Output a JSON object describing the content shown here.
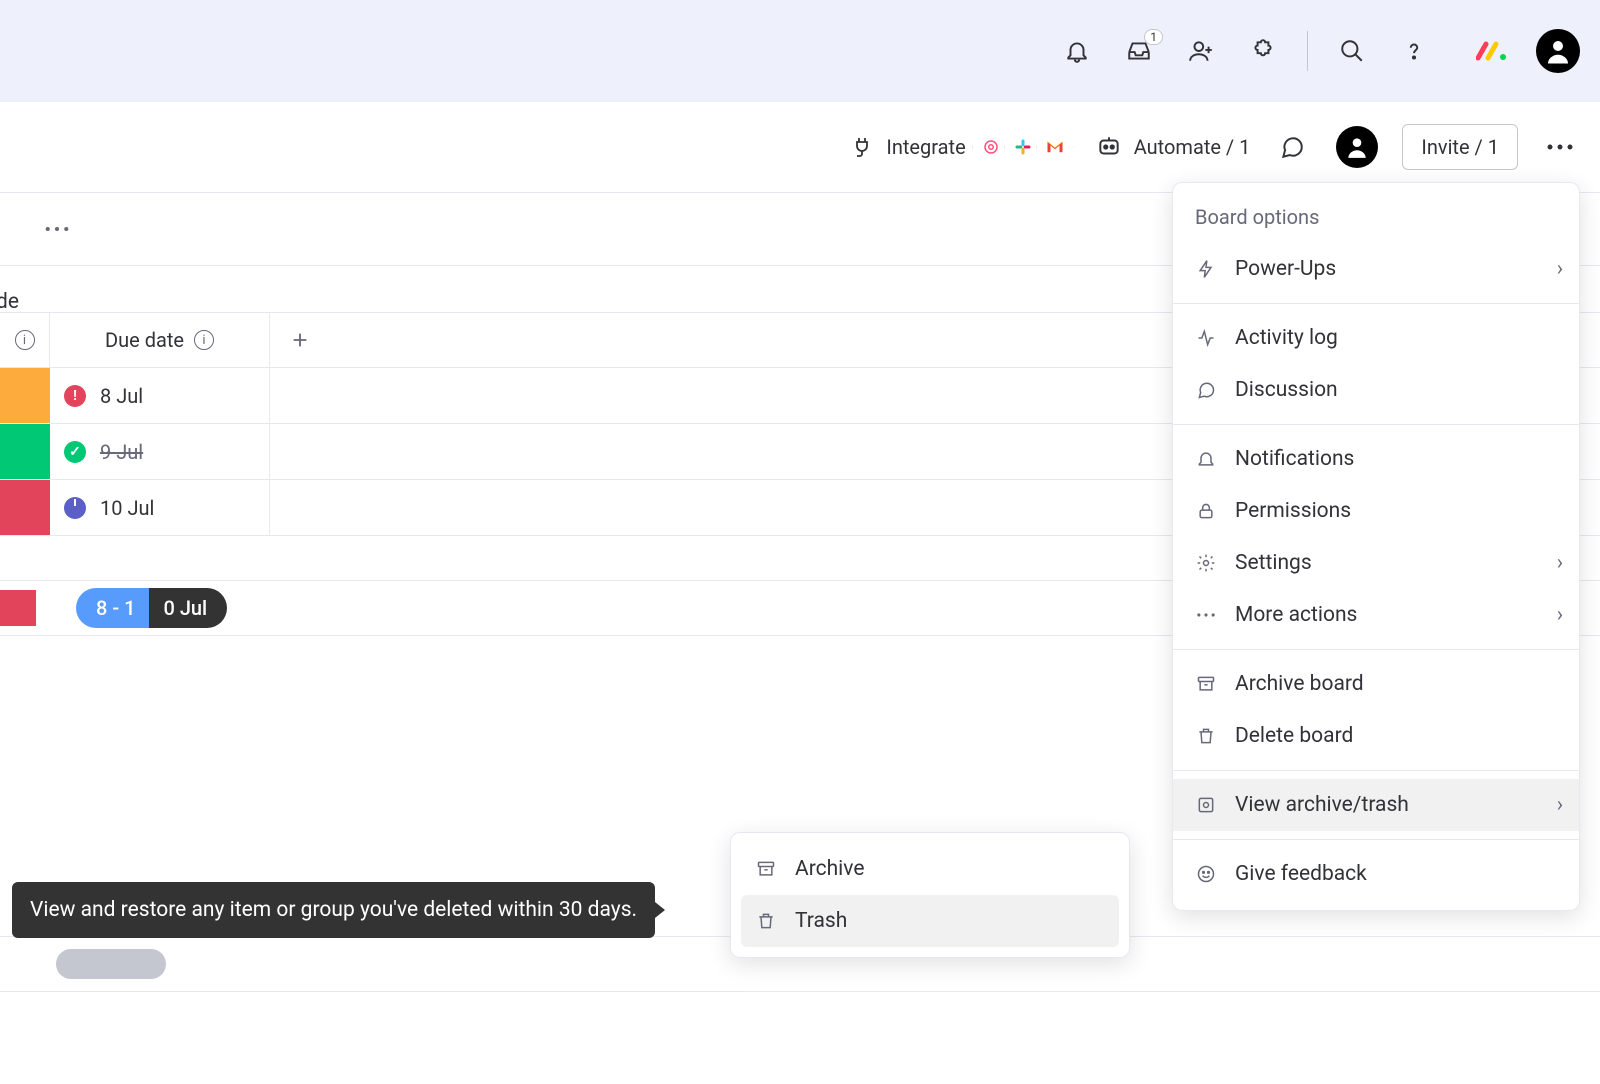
{
  "topbar": {
    "inbox_badge": "1"
  },
  "toolbar": {
    "integrate_label": "Integrate",
    "automate_label": "Automate / 1",
    "invite_label": "Invite / 1"
  },
  "secrow": {
    "partial_label": "de"
  },
  "table": {
    "header": {
      "due_date": "Due date"
    },
    "rows": [
      {
        "status_color": "status-orange",
        "dot": "dot-red",
        "dot_glyph": "!",
        "date": "8 Jul",
        "strike": false
      },
      {
        "status_color": "status-green",
        "dot": "dot-green",
        "dot_glyph": "✓",
        "date": "9 Jul",
        "strike": true
      },
      {
        "status_color": "status-red",
        "dot": "dot-blue",
        "dot_glyph": "",
        "date": "10 Jul",
        "strike": false
      }
    ],
    "summary_pill_left": "8 - 1",
    "summary_pill_right": "0 Jul"
  },
  "menu": {
    "title": "Board options",
    "items": [
      {
        "label": "Power-Ups",
        "icon": "lightning-icon",
        "chev": true
      },
      {
        "sep": true
      },
      {
        "label": "Activity log",
        "icon": "activity-icon"
      },
      {
        "label": "Discussion",
        "icon": "chat-icon"
      },
      {
        "sep": true
      },
      {
        "label": "Notifications",
        "icon": "bell-icon"
      },
      {
        "label": "Permissions",
        "icon": "lock-icon"
      },
      {
        "label": "Settings",
        "icon": "gear-icon",
        "chev": true
      },
      {
        "label": "More actions",
        "icon": "dots-icon",
        "chev": true
      },
      {
        "sep": true
      },
      {
        "label": "Archive board",
        "icon": "archive-icon"
      },
      {
        "label": "Delete board",
        "icon": "trash-icon"
      },
      {
        "sep": true
      },
      {
        "label": "View archive/trash",
        "icon": "folder-icon",
        "chev": true,
        "highlight": true
      },
      {
        "sep": true
      },
      {
        "label": "Give feedback",
        "icon": "smile-icon"
      }
    ]
  },
  "submenu": {
    "items": [
      {
        "label": "Archive",
        "icon": "archive-icon"
      },
      {
        "label": "Trash",
        "icon": "trash-icon",
        "hover": true
      }
    ]
  },
  "tooltip": {
    "text": "View and restore any item or group you've deleted within 30 days."
  }
}
